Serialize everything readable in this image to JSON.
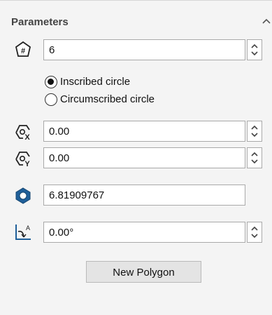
{
  "panel": {
    "title": "Parameters",
    "collapse_icon": "chevron-up-icon"
  },
  "sides": {
    "icon": "polygon-sides-icon",
    "value": "6"
  },
  "options": [
    {
      "label": "Inscribed circle",
      "selected": true
    },
    {
      "label": "Circumscribed circle",
      "selected": false
    }
  ],
  "center_x": {
    "icon": "center-x-icon",
    "value": "0.00"
  },
  "center_y": {
    "icon": "center-y-icon",
    "value": "0.00"
  },
  "circle_diameter": {
    "icon": "polygon-diameter-icon",
    "value": "6.81909767"
  },
  "angle": {
    "icon": "angle-icon",
    "value": "0.00°"
  },
  "new_polygon_button": "New Polygon"
}
